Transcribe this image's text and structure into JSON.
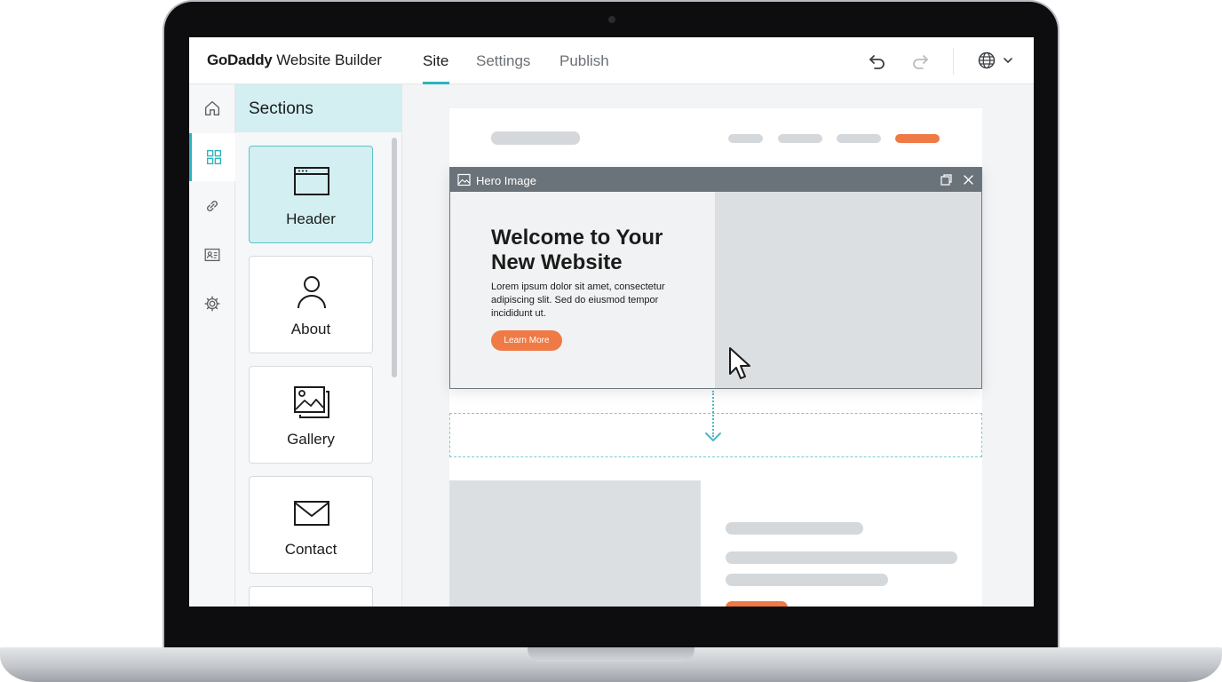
{
  "header": {
    "brand_strong": "GoDaddy",
    "brand_rest": " Website Builder",
    "tabs": [
      {
        "label": "Site",
        "active": true
      },
      {
        "label": "Settings",
        "active": false
      },
      {
        "label": "Publish",
        "active": false
      }
    ],
    "icons": [
      "undo-icon",
      "redo-icon",
      "globe-icon",
      "chevron-down-icon"
    ]
  },
  "rail": {
    "items": [
      {
        "icon": "home-icon",
        "active": false
      },
      {
        "icon": "grid-icon",
        "active": true
      },
      {
        "icon": "link-icon",
        "active": false
      },
      {
        "icon": "profile-card-icon",
        "active": false
      },
      {
        "icon": "gear-icon",
        "active": false
      }
    ]
  },
  "sections_panel": {
    "title": "Sections",
    "cards": [
      {
        "label": "Header",
        "icon": "browser-window-icon",
        "active": true
      },
      {
        "label": "About",
        "icon": "person-icon",
        "active": false
      },
      {
        "label": "Gallery",
        "icon": "image-stack-icon",
        "active": false
      },
      {
        "label": "Contact",
        "icon": "envelope-icon",
        "active": false
      }
    ]
  },
  "hero": {
    "bar_label": "Hero Image",
    "title": "Welcome to Your New Website",
    "body": "Lorem ipsum dolor sit amet, consectetur adipiscing slit. Sed do eiusmod tempor incididunt ut.",
    "button_label": "Learn More"
  },
  "colors": {
    "accent": "#2bb3bf",
    "accent_light": "#d3eff1",
    "cta": "#ef7a45",
    "placeholder": "#d5d8db"
  }
}
